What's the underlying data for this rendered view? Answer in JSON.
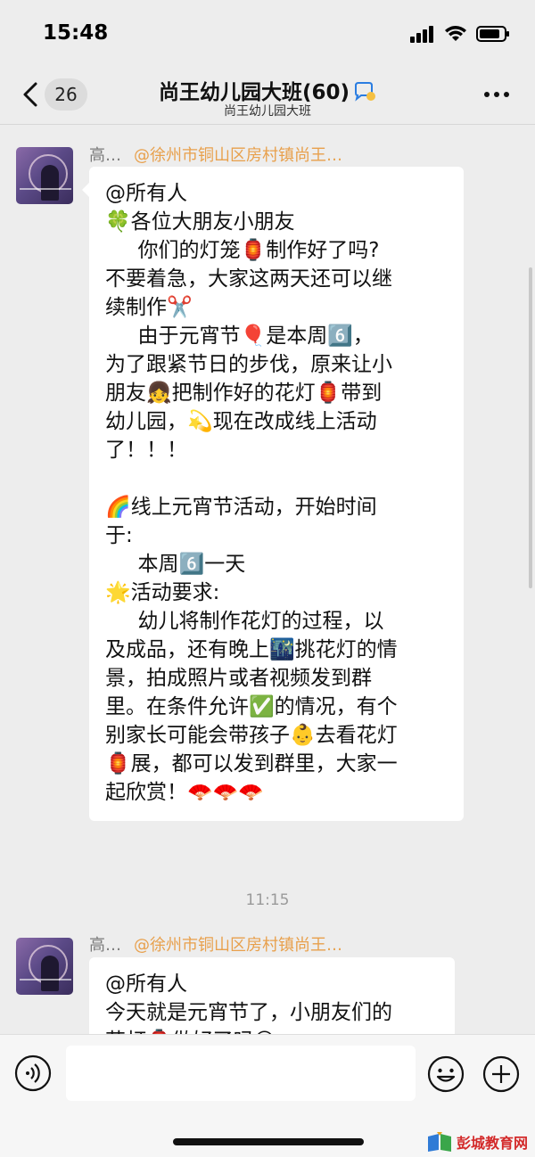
{
  "status": {
    "time": "15:48"
  },
  "nav": {
    "unread_count": "26",
    "title": "尚王幼儿园大班(60)",
    "subtitle": "尚王幼儿园大班"
  },
  "messages": [
    {
      "sender": "高…",
      "group_nick": "@徐州市铜山区房村镇尚王…",
      "lines": [
        "@所有人",
        "🍀各位大朋友小朋友",
        "     你们的灯笼🏮制作好了吗?",
        "不要着急，大家这两天还可以继",
        "续制作✂️",
        "     由于元宵节🎈是本周6️⃣，",
        "为了跟紧节日的步伐，原来让小",
        "朋友👧把制作好的花灯🏮带到",
        "幼儿园，💫现在改成线上活动",
        "了！！！",
        "",
        "🌈线上元宵节活动，开始时间",
        "于:",
        "     本周6️⃣一天",
        "🌟活动要求:",
        "     幼儿将制作花灯的过程，以",
        "及成品，还有晚上🌃挑花灯的情",
        "景，拍成照片或者视频发到群",
        "里。在条件允许✅的情况，有个",
        "别家长可能会带孩子👶去看花灯",
        "🏮展，都可以发到群里，大家一",
        "起欣赏！🪭🪭🪭"
      ]
    },
    {
      "sender": "高…",
      "group_nick": "@徐州市铜山区房村镇尚王…",
      "lines": [
        "@所有人",
        "今天就是元宵节了，小朋友们的",
        "花灯🏮做好了吗😊"
      ]
    }
  ],
  "timestamp": "11:15",
  "input": {
    "placeholder": ""
  },
  "watermark": {
    "text": "彭城教育网"
  },
  "colors": {
    "background": "#ededed",
    "bubble": "#ffffff",
    "group_nick": "#e8a04c",
    "watermark": "#d32a2a"
  }
}
